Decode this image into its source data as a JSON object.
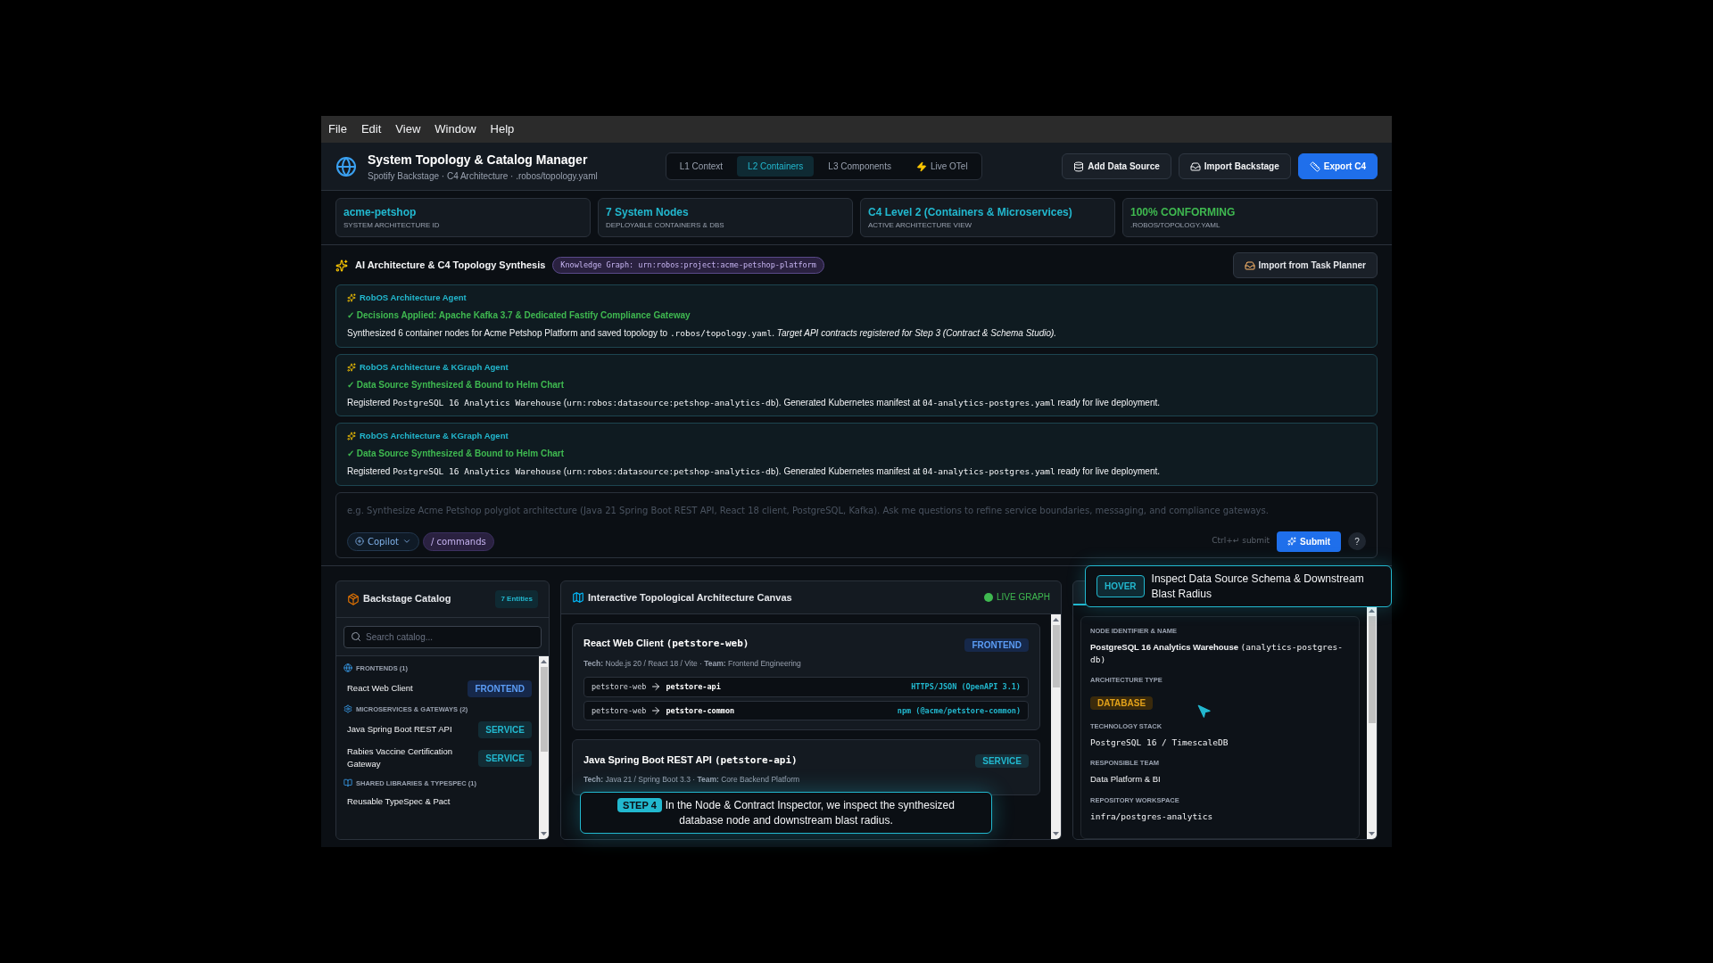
{
  "menu": [
    "File",
    "Edit",
    "View",
    "Window",
    "Help"
  ],
  "app": {
    "title": "System Topology & Catalog Manager",
    "subtitle": "Spotify Backstage · C4 Architecture · .robos/topology.yaml",
    "tabs": [
      {
        "label": "L1 Context",
        "selected": false,
        "kind": "plain"
      },
      {
        "label": "L2 Containers",
        "selected": true,
        "kind": "plain"
      },
      {
        "label": "L3 Components",
        "selected": false,
        "kind": "plain"
      },
      {
        "label": "Live OTel",
        "selected": false,
        "kind": "live"
      }
    ],
    "actions": [
      {
        "label": "Add Data Source",
        "kind": "database",
        "primary": false
      },
      {
        "label": "Import Backstage",
        "kind": "import",
        "primary": false
      },
      {
        "label": "Export C4",
        "kind": "ruler",
        "primary": true
      }
    ]
  },
  "stats": [
    {
      "value": "acme-petshop",
      "caption": "SYSTEM ARCHITECTURE ID",
      "kind": "info"
    },
    {
      "value": "7 System Nodes",
      "caption": "DEPLOYABLE CONTAINERS & DBS",
      "kind": "info"
    },
    {
      "value": "C4 Level 2 (Containers & Microservices)",
      "caption": "ACTIVE ARCHITECTURE VIEW",
      "kind": "info"
    },
    {
      "value": "100% CONFORMING",
      "caption": ".ROBOS/TOPOLOGY.YAML",
      "kind": "success"
    }
  ],
  "synthesis": {
    "title": "AI Architecture & C4 Topology Synthesis",
    "graph_badge": "Knowledge Graph: urn:robos:project:acme-petshop-platform",
    "import_button": "Import from Task Planner",
    "messages": [
      {
        "agent": "RobOS Architecture Agent",
        "decision": "✓ Decisions Applied: Apache Kafka 3.7 & Dedicated Fastify Compliance Gateway",
        "body": [
          {
            "kind": "plain",
            "text": "Synthesized 6 container nodes for Acme Petshop Platform and saved topology to "
          },
          {
            "kind": "code",
            "text": ".robos/topology.yaml"
          },
          {
            "kind": "plain",
            "text": ". "
          },
          {
            "kind": "italic",
            "text": "Target API contracts registered for Step 3 (Contract & Schema Studio)."
          }
        ]
      },
      {
        "agent": "RobOS Architecture & KGraph Agent",
        "decision": "✓ Data Source Synthesized & Bound to Helm Chart",
        "body": [
          {
            "kind": "plain",
            "text": "Registered "
          },
          {
            "kind": "code",
            "text": "PostgreSQL 16 Analytics Warehouse"
          },
          {
            "kind": "plain",
            "text": " ("
          },
          {
            "kind": "code",
            "text": "urn:robos:datasource:petshop-analytics-db"
          },
          {
            "kind": "plain",
            "text": "). Generated Kubernetes manifest at "
          },
          {
            "kind": "code",
            "text": "04-analytics-postgres.yaml"
          },
          {
            "kind": "plain",
            "text": " ready for live deployment."
          }
        ]
      },
      {
        "agent": "RobOS Architecture & KGraph Agent",
        "decision": "✓ Data Source Synthesized & Bound to Helm Chart",
        "body": [
          {
            "kind": "plain",
            "text": "Registered "
          },
          {
            "kind": "code",
            "text": "PostgreSQL 16 Analytics Warehouse"
          },
          {
            "kind": "plain",
            "text": " ("
          },
          {
            "kind": "code",
            "text": "urn:robos:datasource:petshop-analytics-db"
          },
          {
            "kind": "plain",
            "text": "). Generated Kubernetes manifest at "
          },
          {
            "kind": "code",
            "text": "04-analytics-postgres.yaml"
          },
          {
            "kind": "plain",
            "text": " ready for live deployment."
          }
        ]
      }
    ]
  },
  "composer": {
    "placeholder": "e.g. Synthesize Acme Petshop polyglot architecture (Java 21 Spring Boot REST API, React 18 client, PostgreSQL, Kafka). Ask me questions to refine service boundaries, messaging, and compliance gateways.",
    "mode": "Copilot",
    "commands": "/ commands",
    "hint": "Ctrl+↵ submit",
    "submit": "Submit",
    "help": "?"
  },
  "catalog": {
    "title": "Backstage Catalog",
    "count": "7 Entities",
    "search_placeholder": "Search catalog...",
    "groups": [
      {
        "label": "FRONTENDS (1)",
        "kind": "frontend",
        "items": [
          {
            "name": "React Web Client",
            "tag": "FRONTEND",
            "color": "#16284a"
          }
        ]
      },
      {
        "label": "MICROSERVICES & GATEWAYS (2)",
        "kind": "service",
        "items": [
          {
            "name": "Java Spring Boot REST API",
            "tag": "SERVICE",
            "color": "#22b8cf"
          },
          {
            "name": "Rabies Vaccine Certification Gateway",
            "tag": "SERVICE",
            "color": "#22b8cf"
          }
        ]
      },
      {
        "label": "SHARED LIBRARIES & TYPESPEC (1)",
        "kind": "library",
        "items": [
          {
            "name": "Reusable TypeSpec & Pact"
          }
        ]
      }
    ]
  },
  "canvas": {
    "title": "Interactive Topological Architecture Canvas",
    "status": "LIVE GRAPH",
    "nodes": [
      {
        "name": "React Web Client",
        "id": "(petstore-web)",
        "tag": "FRONTEND",
        "color": "#16284a",
        "meta": "**Tech:** Node.js 20 / React 18 / Vite · **Team:** Frontend Engineering",
        "links": [
          {
            "from": "petstore-web",
            "to": "petstore-api",
            "protocol": "HTTPS/JSON (OpenAPI 3.1)"
          },
          {
            "from": "petstore-web",
            "to": "petstore-common",
            "protocol": "npm (@acme/petstore-common)"
          }
        ]
      },
      {
        "name": "Java Spring Boot REST API",
        "id": "(petstore-api)",
        "tag": "SERVICE",
        "color": "#22b8cf",
        "meta": "**Tech:** Java 21 / Spring Boot 3.3 · **Team:** Core Backend Platform"
      }
    ]
  },
  "inspector": {
    "fields": [
      {
        "label": "NODE IDENTIFIER & NAME",
        "kind": "name",
        "value": "PostgreSQL 16 Analytics Warehouse",
        "id": "(analytics-postgres-db)"
      },
      {
        "label": "ARCHITECTURE TYPE",
        "kind": "badge",
        "value": "DATABASE"
      },
      {
        "label": "TECHNOLOGY STACK",
        "kind": "mono",
        "value": "PostgreSQL 16 / TimescaleDB"
      },
      {
        "label": "RESPONSIBLE TEAM",
        "kind": "text",
        "value": "Data Platform & BI"
      },
      {
        "label": "REPOSITORY WORKSPACE",
        "kind": "mono",
        "value": "infra/postgres-analytics"
      }
    ]
  },
  "tour": {
    "hover_tag": "HOVER",
    "hover_text": "Inspect Data Source Schema & Downstream Blast Radius",
    "step_tag": "STEP 4",
    "step_text": "In the Node & Contract Inspector, we inspect the synthesized database node and downstream blast radius."
  }
}
